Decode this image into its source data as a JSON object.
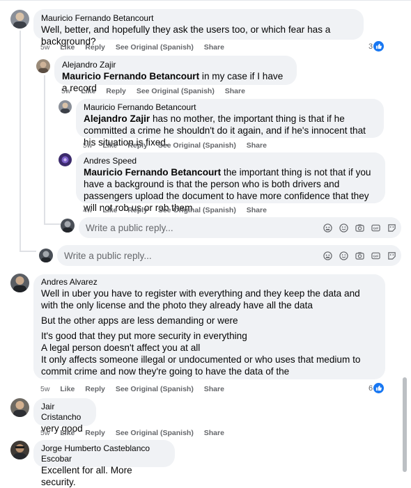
{
  "actions": {
    "like": "Like",
    "reply": "Reply",
    "see_original": "See Original (Spanish)",
    "share": "Share"
  },
  "comments": [
    {
      "author": "Mauricio Fernando Betancourt",
      "text": "Well, better, and hopefully they ask the users too, or which fear has a background?",
      "time": "5w",
      "reactions": "3"
    },
    {
      "author": "Alejandro Zajir",
      "mention": "Mauricio Fernando Betancourt",
      "text": " in my case if I have a record",
      "time": "5w"
    },
    {
      "author": "Mauricio Fernando Betancourt",
      "mention": "Alejandro Zajir",
      "text": " has no mother, the important thing is that if he committed a crime he shouldn't do it again, and if he's innocent that his situation is fixed.",
      "time": "5w"
    },
    {
      "author": "Andres Speed",
      "mention": "Mauricio Fernando Betancourt",
      "text": " the important thing is not that if you have a background is that the person who is both drivers and passengers upload the document to have more confidence that they will not rob us or rob them",
      "time": "4w"
    },
    {
      "author": "Andres Alvarez",
      "paragraphs": [
        "Well in uber you have to register with everything and they keep the data and with the only license and the photo they already have all the data",
        "But the other apps are less demanding or were",
        "It's good that they put more security in everything\nA legal person doesn't affect you at all\nIt only affects someone illegal or undocumented or who uses that medium to commit crime and now they're going to have the data of the"
      ],
      "time": "5w",
      "reactions": "6"
    },
    {
      "author": "Jair Cristancho",
      "text": "very good",
      "time": "5w"
    },
    {
      "author": "Jorge Humberto Casteblanco Escobar",
      "text": "Excellent for all. More security."
    }
  ],
  "reply_box": {
    "placeholder": "Write a public reply..."
  },
  "icons": [
    "emoji-sticker-icon",
    "smiley-icon",
    "camera-icon",
    "gif-icon",
    "sticker-icon",
    "like-thumb-icon"
  ],
  "colors": {
    "bubble": "#f0f2f5",
    "meta": "#65676b",
    "like_blue": "#1877f2"
  }
}
